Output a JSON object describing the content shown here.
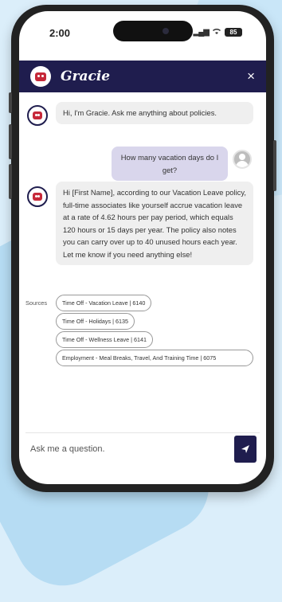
{
  "status_bar": {
    "time": "2:00",
    "battery": "85"
  },
  "header": {
    "title": "Gracie",
    "close_icon": "×"
  },
  "messages": [
    {
      "role": "bot",
      "text": "Hi, I'm Gracie. Ask me anything about policies."
    },
    {
      "role": "user",
      "text": "How many vacation days do I get?"
    },
    {
      "role": "bot",
      "text": "Hi [First Name], according to our Vacation Leave policy, full-time associates like yourself accrue vacation leave at a rate of 4.62 hours per pay period, which equals 120 hours or 15 days per year. The policy also notes you can carry over up to 40 unused hours each year. Let me know if you need anything else!"
    }
  ],
  "sources": {
    "label": "Sources",
    "items": [
      "Time Off - Vacation Leave | 6140",
      "Time Off - Holidays | 6135",
      "Time Off - Wellness Leave | 6141",
      "Employment - Meal Breaks, Travel, And Training Time | 6075"
    ]
  },
  "composer": {
    "placeholder": "Ask me a question."
  },
  "colors": {
    "brand": "#1f1d4e",
    "accent": "#c62839",
    "user_bubble": "#d9d6ec",
    "bot_bubble": "#efefef",
    "background": "#dbeefa"
  },
  "icons": {
    "logo": "robot-logo-icon",
    "close": "close-icon",
    "send": "send-icon",
    "user": "user-avatar-icon"
  }
}
